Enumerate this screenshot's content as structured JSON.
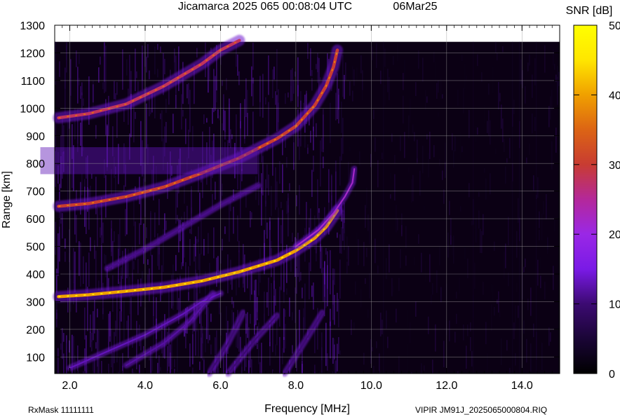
{
  "header": {
    "title": "Jicamarca 2025 065 00:08:04 UTC",
    "date": "06Mar25"
  },
  "footer": {
    "rx_mask": "RxMask 11111111",
    "file": "VIPIR  JM91J_2025065000804.RIQ"
  },
  "colorbar": {
    "title": "SNR [dB]",
    "ticks": [
      "50",
      "40",
      "30",
      "20",
      "10",
      "0"
    ],
    "range": [
      0,
      50
    ],
    "colormap": [
      "#000000",
      "#1a0536",
      "#3c0a72",
      "#7a1ae6",
      "#9a28e6",
      "#b4289a",
      "#c83c32",
      "#dc6414",
      "#f0a000",
      "#ffe600",
      "#ffff00"
    ]
  },
  "chart_data": {
    "type": "heatmap",
    "xlabel": "Frequency [MHz]",
    "ylabel": "Range [km]",
    "xlim": [
      1.6,
      15.0
    ],
    "ylim": [
      40,
      1300
    ],
    "x_ticks": [
      "2.0",
      "4.0",
      "6.0",
      "8.0",
      "10.0",
      "12.0",
      "14.0"
    ],
    "y_ticks": [
      "100",
      "200",
      "300",
      "400",
      "500",
      "600",
      "700",
      "800",
      "900",
      "1000",
      "1100",
      "1200",
      "1300"
    ],
    "data_range_max": 1240,
    "background_cutoff_mhz": 9.3,
    "traces": [
      {
        "name": "E/F1 trace",
        "snr_db": 40,
        "points": [
          [
            1.7,
            318
          ],
          [
            2.5,
            325
          ],
          [
            3.5,
            338
          ],
          [
            4.5,
            352
          ],
          [
            5.5,
            375
          ],
          [
            6.5,
            408
          ],
          [
            7.5,
            450
          ],
          [
            8.0,
            485
          ],
          [
            8.5,
            530
          ],
          [
            8.8,
            570
          ],
          [
            9.0,
            610
          ],
          [
            9.1,
            630
          ]
        ]
      },
      {
        "name": "F trace thin",
        "snr_db": 22,
        "points": [
          [
            8.0,
            500
          ],
          [
            8.6,
            560
          ],
          [
            9.0,
            620
          ],
          [
            9.3,
            680
          ],
          [
            9.5,
            730
          ],
          [
            9.55,
            780
          ]
        ]
      },
      {
        "name": "2F echo",
        "snr_db": 30,
        "points": [
          [
            1.7,
            645
          ],
          [
            2.5,
            655
          ],
          [
            3.5,
            680
          ],
          [
            4.5,
            715
          ],
          [
            5.5,
            765
          ],
          [
            6.5,
            820
          ],
          [
            7.5,
            890
          ],
          [
            8.0,
            935
          ],
          [
            8.5,
            1010
          ],
          [
            8.8,
            1080
          ],
          [
            9.0,
            1150
          ],
          [
            9.1,
            1210
          ]
        ]
      },
      {
        "name": "3F echo",
        "snr_db": 28,
        "points": [
          [
            1.7,
            965
          ],
          [
            2.5,
            980
          ],
          [
            3.5,
            1015
          ],
          [
            4.5,
            1080
          ],
          [
            5.0,
            1120
          ],
          [
            5.5,
            1160
          ],
          [
            6.0,
            1210
          ],
          [
            6.5,
            1245
          ]
        ]
      },
      {
        "name": "diffuse band",
        "snr_db": 12,
        "points": [
          [
            1.7,
            780
          ],
          [
            2.5,
            790
          ],
          [
            3.5,
            800
          ],
          [
            4.5,
            810
          ],
          [
            5.5,
            820
          ],
          [
            6.5,
            840
          ]
        ]
      },
      {
        "name": "low oblique",
        "snr_db": 13,
        "points": [
          [
            2.0,
            60
          ],
          [
            3.0,
            120
          ],
          [
            4.0,
            180
          ],
          [
            5.0,
            255
          ],
          [
            5.5,
            300
          ],
          [
            6.0,
            330
          ]
        ]
      },
      {
        "name": "low oblique 2",
        "snr_db": 12,
        "points": [
          [
            3.5,
            70
          ],
          [
            4.5,
            150
          ],
          [
            5.2,
            230
          ],
          [
            5.8,
            330
          ]
        ]
      },
      {
        "name": "mid oblique",
        "snr_db": 11,
        "points": [
          [
            3.0,
            420
          ],
          [
            4.0,
            490
          ],
          [
            5.0,
            570
          ],
          [
            6.0,
            650
          ],
          [
            7.0,
            720
          ]
        ]
      },
      {
        "name": "steep streak a",
        "snr_db": 10,
        "points": [
          [
            5.7,
            40
          ],
          [
            6.2,
            150
          ],
          [
            6.6,
            260
          ]
        ]
      },
      {
        "name": "steep streak b",
        "snr_db": 10,
        "points": [
          [
            6.2,
            40
          ],
          [
            6.9,
            160
          ],
          [
            7.5,
            250
          ]
        ]
      },
      {
        "name": "steep streak c",
        "snr_db": 10,
        "points": [
          [
            7.7,
            40
          ],
          [
            8.3,
            170
          ],
          [
            8.7,
            260
          ]
        ]
      }
    ]
  }
}
